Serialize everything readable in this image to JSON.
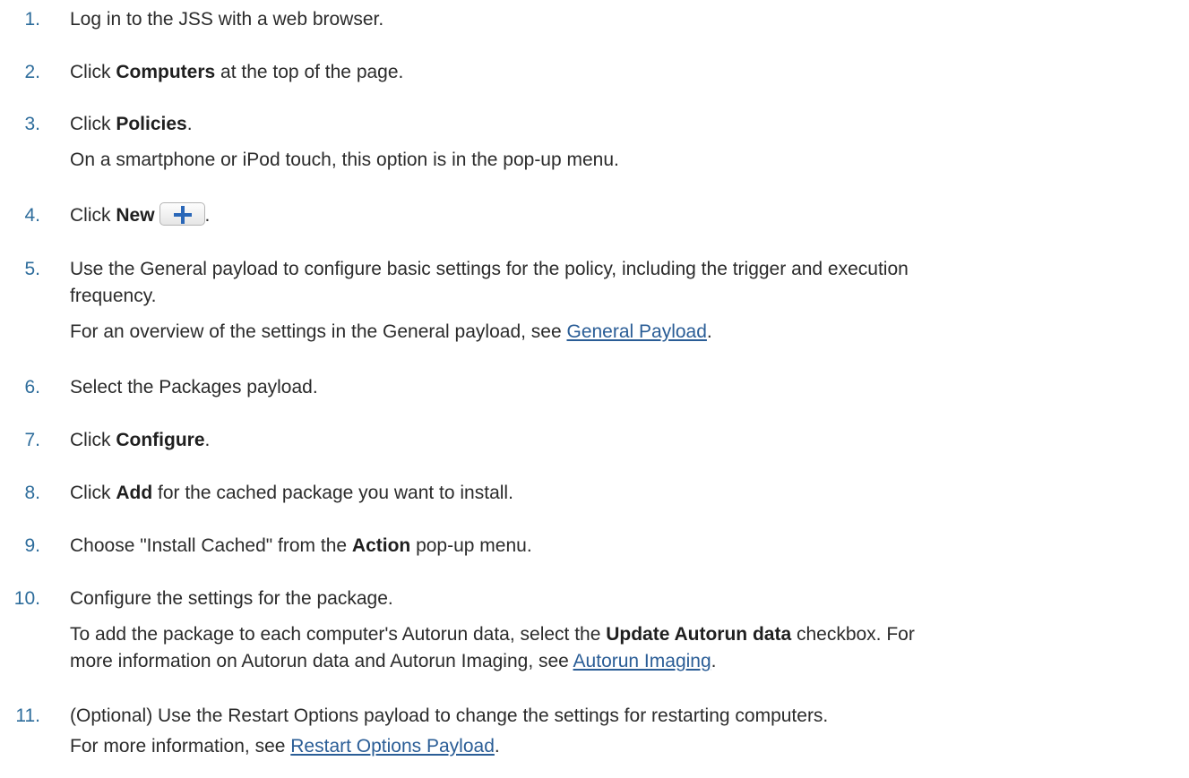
{
  "steps": [
    {
      "num": "1.",
      "parts": [
        "Log in to the JSS with a web browser."
      ]
    },
    {
      "num": "2.",
      "parts": [
        "Click ",
        "Computers",
        " at the top of the page."
      ]
    },
    {
      "num": "3.",
      "parts": [
        "Click ",
        "Policies",
        "."
      ],
      "note": "On a smartphone or iPod touch, this option is in the pop-up menu."
    },
    {
      "num": "4.",
      "parts": [
        "Click ",
        "New",
        "."
      ],
      "button_icon": "plus-icon"
    },
    {
      "num": "5.",
      "lines": [
        "Use the General payload to configure basic settings for the policy, including the trigger and execution",
        "frequency."
      ],
      "note_parts": [
        "For an overview of the settings in the General payload, see ",
        "General Payload",
        "."
      ]
    },
    {
      "num": "6.",
      "parts": [
        "Select the Packages payload."
      ]
    },
    {
      "num": "7.",
      "parts": [
        "Click ",
        "Configure",
        "."
      ]
    },
    {
      "num": "8.",
      "parts": [
        "Click ",
        "Add",
        " for the cached package you want to install."
      ]
    },
    {
      "num": "9.",
      "parts": [
        "Choose \"Install Cached\" from the ",
        "Action",
        " pop-up menu."
      ]
    },
    {
      "num": "10.",
      "parts": [
        "Configure the settings for the package."
      ],
      "note_line1_parts": [
        "To add the package to each computer's Autorun data, select the ",
        "Update Autorun data",
        " checkbox. For"
      ],
      "note_line2_parts": [
        "more information on Autorun data and Autorun Imaging, see ",
        "Autorun Imaging",
        "."
      ]
    },
    {
      "num": "11.",
      "parts": [
        "(Optional) Use the Restart Options payload to change the settings for restarting computers."
      ],
      "note_parts": [
        "For more information, see ",
        "Restart Options Payload",
        "."
      ]
    }
  ],
  "colors": {
    "number": "#2d6c9b",
    "text": "#2b2b2b",
    "link": "#2a5d96",
    "button_plus": "#2a67b8"
  }
}
